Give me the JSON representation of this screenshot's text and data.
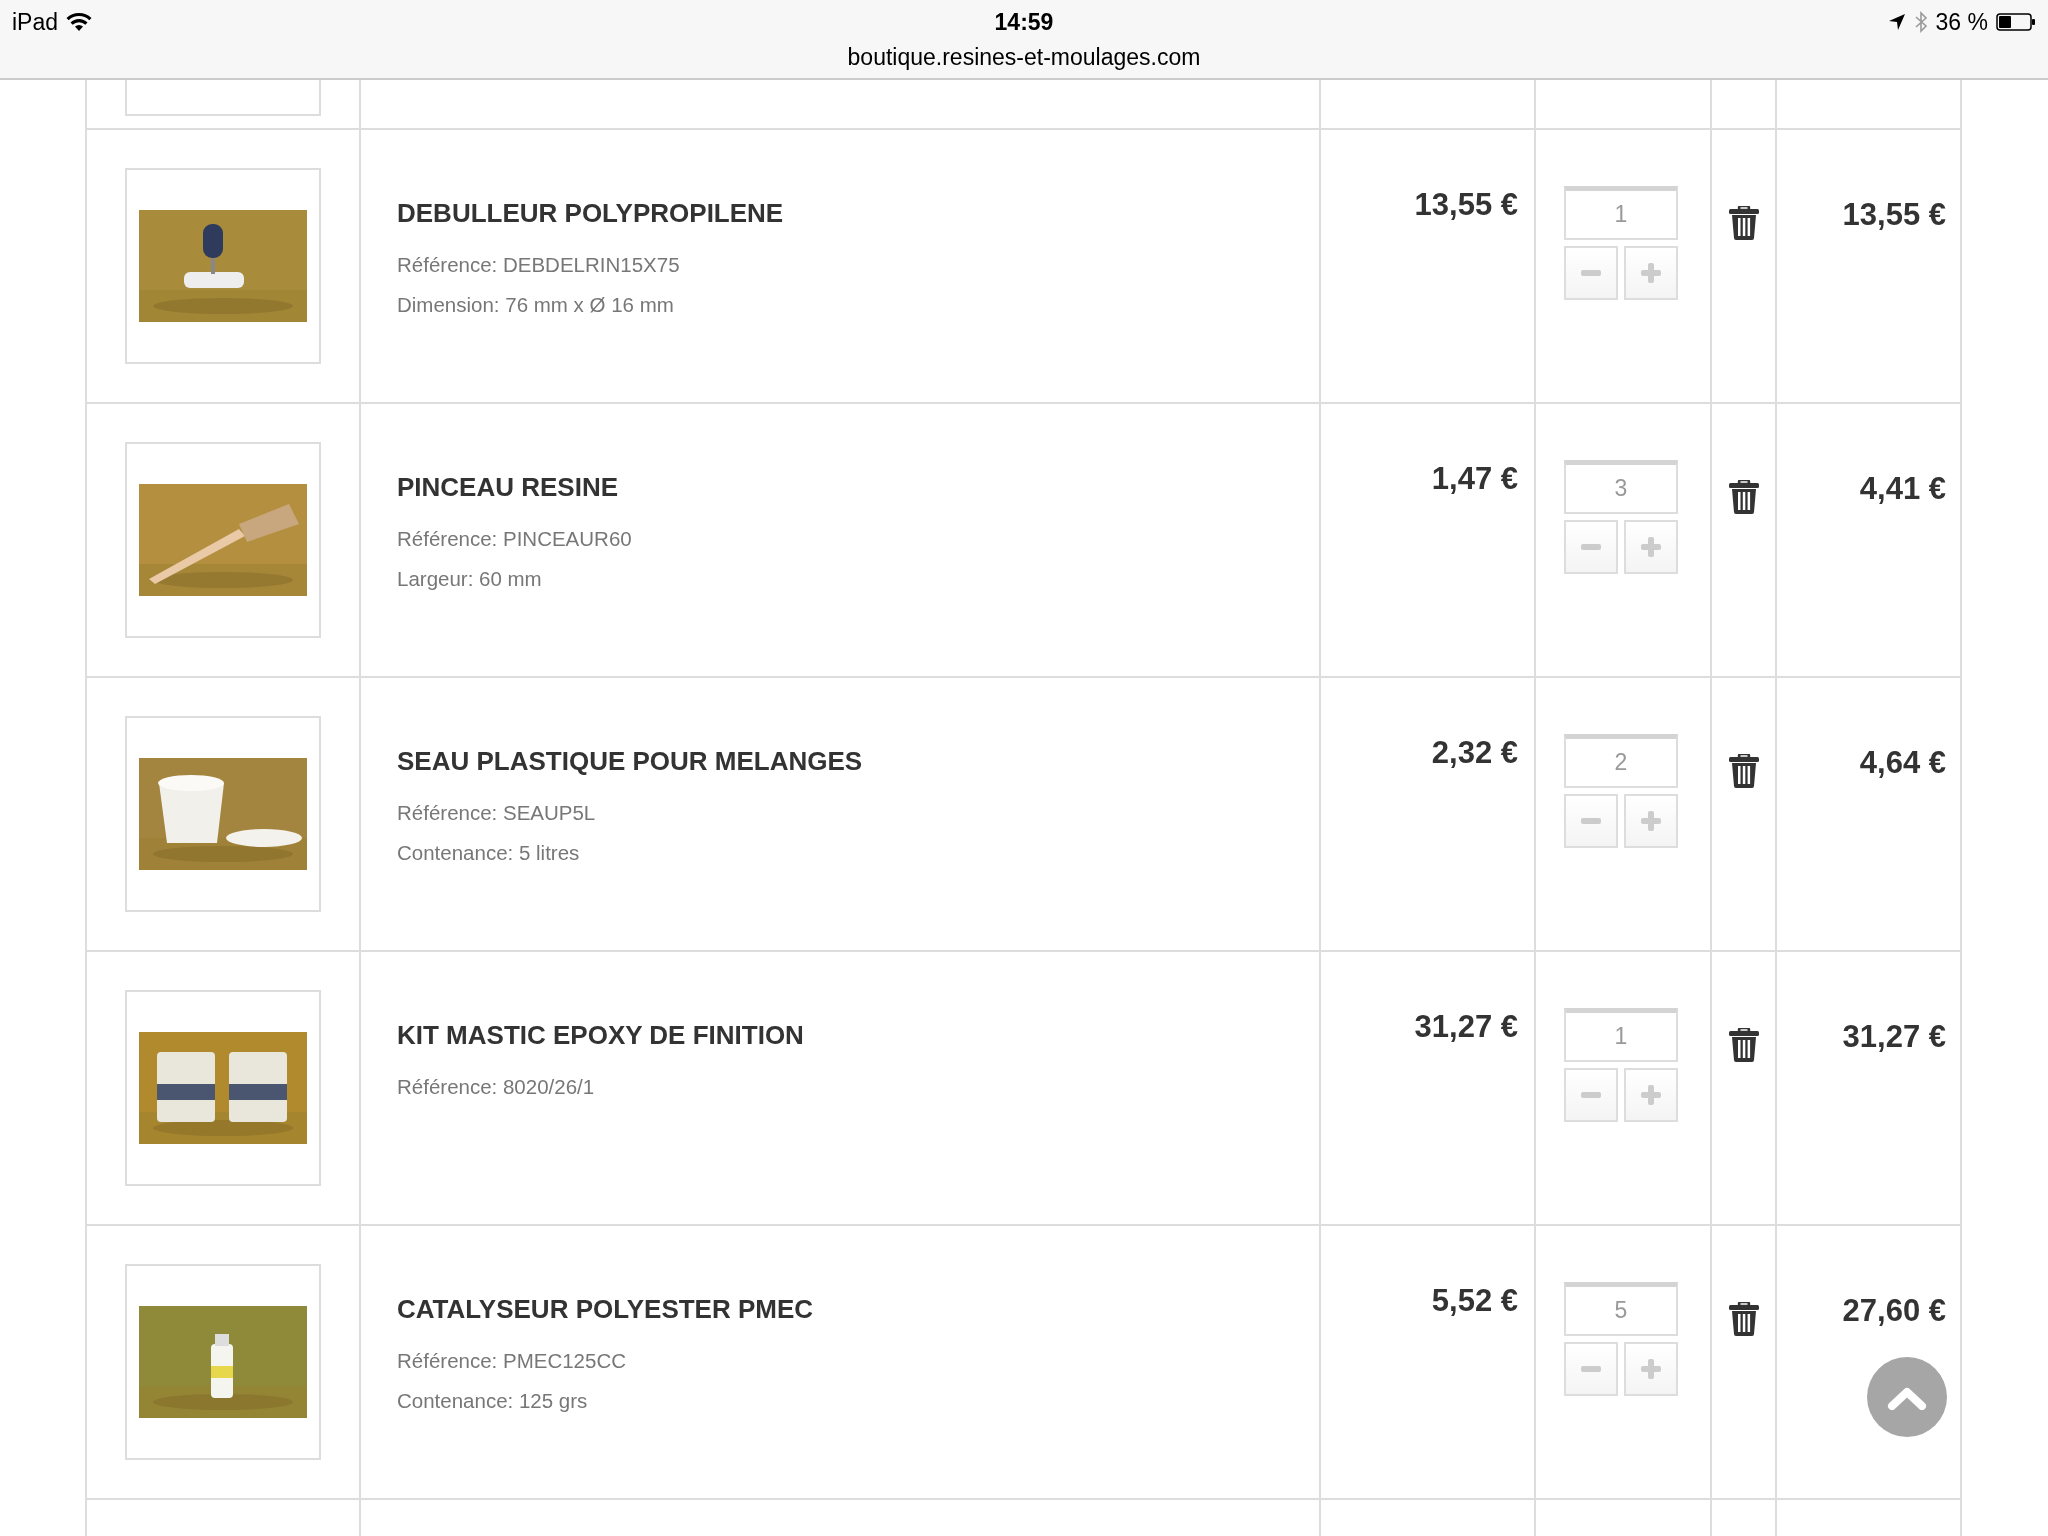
{
  "status_bar": {
    "device": "iPad",
    "time": "14:59",
    "url": "boutique.resines-et-moulages.com",
    "battery": "36 %"
  },
  "cart_rows": [
    {
      "name": "DEBULLEUR POLYPROPILENE",
      "details": [
        "Référence: DEBDELRIN15X75",
        "Dimension: 76 mm x Ø 16 mm"
      ],
      "unit_price": "13,55 €",
      "quantity": "1",
      "total": "13,55 €"
    },
    {
      "name": "PINCEAU RESINE",
      "details": [
        "Référence: PINCEAUR60",
        "Largeur: 60 mm"
      ],
      "unit_price": "1,47 €",
      "quantity": "3",
      "total": "4,41 €"
    },
    {
      "name": "SEAU PLASTIQUE POUR MELANGES",
      "details": [
        "Référence: SEAUP5L",
        "Contenance: 5 litres"
      ],
      "unit_price": "2,32 €",
      "quantity": "2",
      "total": "4,64 €"
    },
    {
      "name": "KIT MASTIC EPOXY DE FINITION",
      "details": [
        "Référence: 8020/26/1"
      ],
      "unit_price": "31,27 €",
      "quantity": "1",
      "total": "31,27 €"
    },
    {
      "name": "CATALYSEUR POLYESTER PMEC",
      "details": [
        "Référence: PMEC125CC",
        "Contenance: 125 grs"
      ],
      "unit_price": "5,52 €",
      "quantity": "5",
      "total": "27,60 €"
    }
  ]
}
